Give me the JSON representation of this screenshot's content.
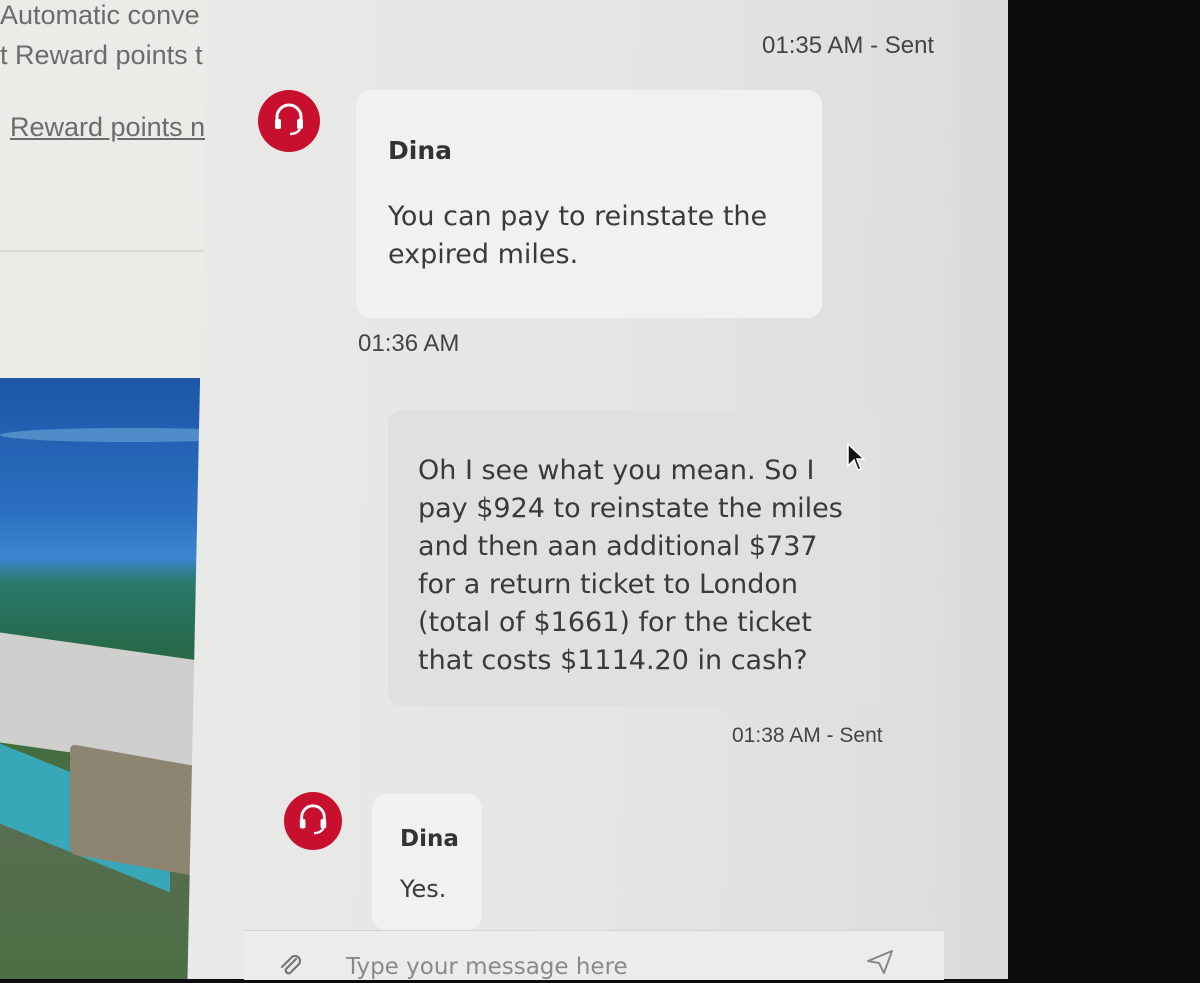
{
  "background_page": {
    "lines": [
      "Automatic conve",
      "t Reward points t",
      "Reward points n"
    ]
  },
  "chat": {
    "messages": [
      {
        "type": "status",
        "time": "01:35 AM - Sent"
      },
      {
        "type": "agent",
        "sender": "Dina",
        "text": "You can pay to reinstate the expired miles.",
        "time": "01:36 AM"
      },
      {
        "type": "user",
        "text": "Oh I see what you mean. So I pay $924 to reinstate the miles and then aan additional $737 for a return ticket to London (total of $1661) for the ticket that costs $1114.20 in cash?",
        "time": "01:38 AM - Sent"
      },
      {
        "type": "agent",
        "sender": "Dina",
        "text": "Yes."
      }
    ],
    "composer": {
      "placeholder": "Type your message here"
    }
  },
  "colors": {
    "accent": "#c8102e",
    "panel": "#e9e9e7",
    "bubble": "#f1f1ef"
  },
  "icons": [
    "headset-icon",
    "attach-icon",
    "send-icon",
    "cursor-icon"
  ]
}
